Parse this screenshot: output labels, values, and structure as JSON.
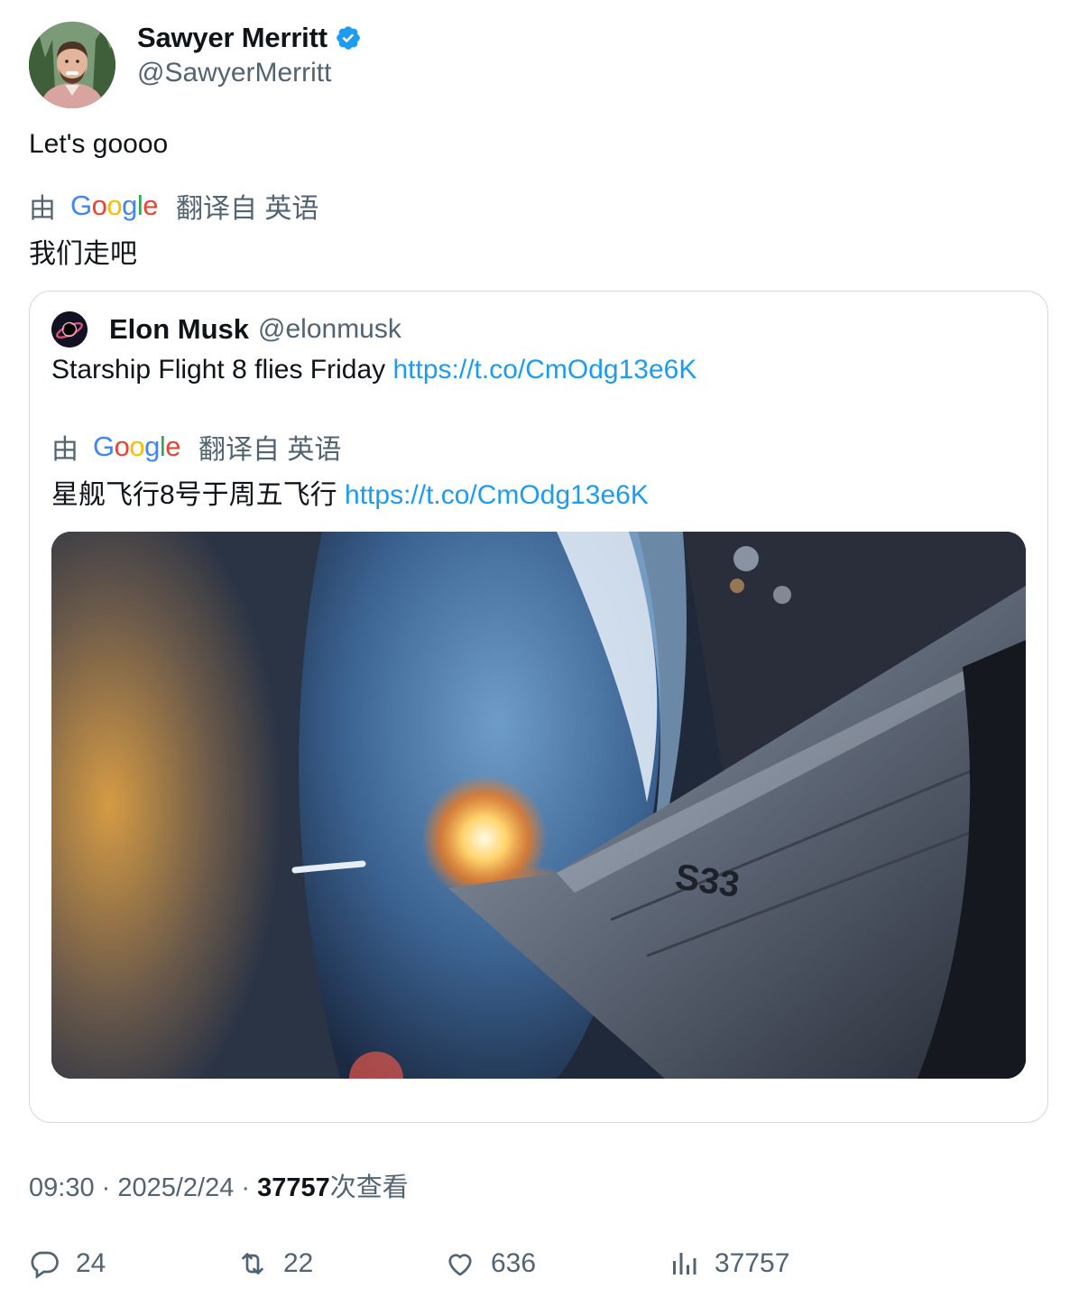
{
  "tweet": {
    "author": {
      "name": "Sawyer Merritt",
      "handle": "@SawyerMerritt",
      "verified_icon": "verified-badge-icon",
      "verified_color": "#1d9bf0"
    },
    "text": "Let's goooo",
    "translation": {
      "by": "由",
      "provider": "Google",
      "note": "翻译自 英语",
      "text": "我们走吧"
    },
    "quoted": {
      "author_name": "Elon Musk",
      "author_handle": "@elonmusk",
      "text": "Starship Flight 8 flies Friday",
      "link": "https://t.co/CmOdg13e6K",
      "translation": {
        "by": "由",
        "provider": "Google",
        "note": "翻译自 英语",
        "text": "星舰飞行8号于周五飞行",
        "link": "https://t.co/CmOdg13e6K"
      },
      "media_label": "S33"
    },
    "timestamp": "09:30 · 2025/2/24 · ",
    "views_count": "37757",
    "views_label": "次查看",
    "actions": {
      "replies": "24",
      "reposts": "22",
      "likes": "636",
      "views": "37757"
    }
  },
  "colors": {
    "text": "#0f1419",
    "secondary": "#536471",
    "link": "#1d9bf0",
    "border": "#cfd9de"
  }
}
